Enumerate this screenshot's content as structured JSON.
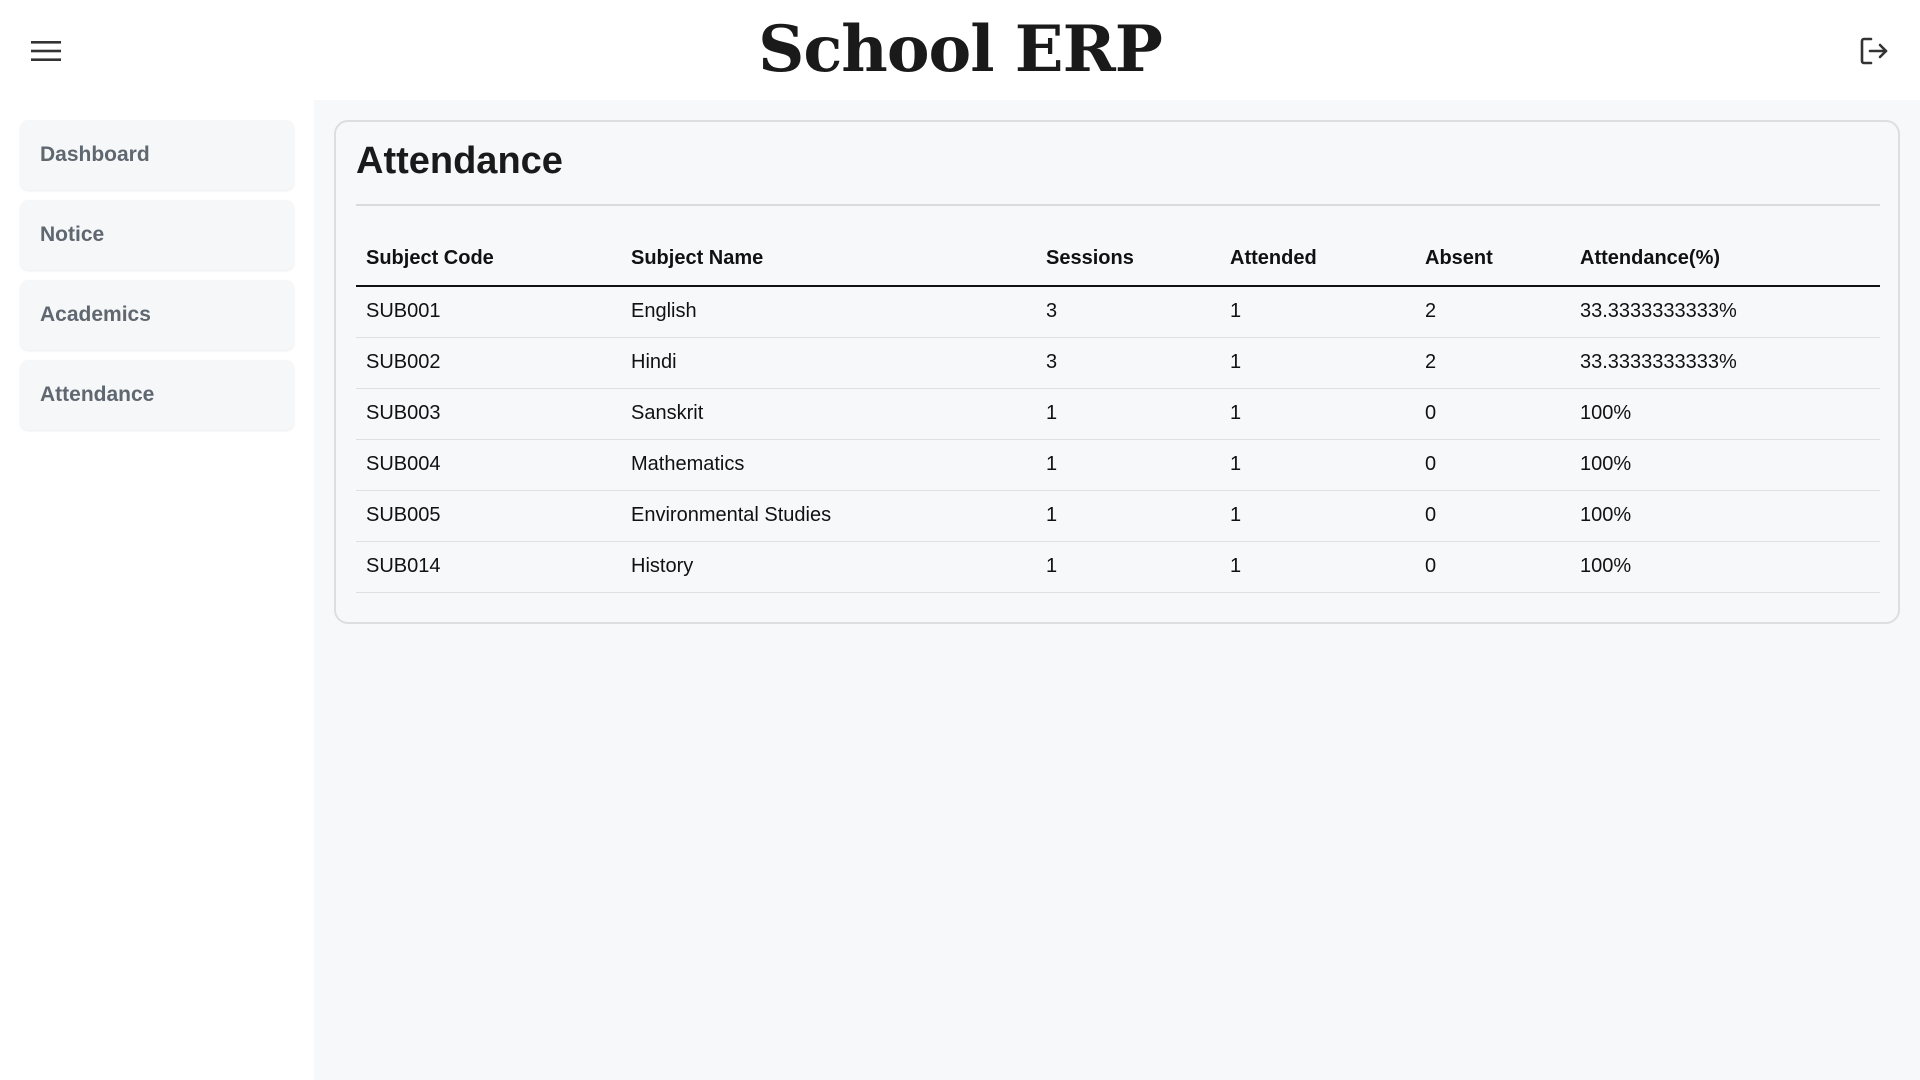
{
  "app": {
    "title": "School ERP",
    "menu_icon": "hamburger-menu-icon",
    "logout_icon": "logout-icon"
  },
  "sidebar": {
    "items": [
      {
        "label": "Dashboard"
      },
      {
        "label": "Notice"
      },
      {
        "label": "Academics"
      },
      {
        "label": "Attendance"
      }
    ]
  },
  "attendance": {
    "title": "Attendance",
    "columns": [
      "Subject Code",
      "Subject Name",
      "Sessions",
      "Attended",
      "Absent",
      "Attendance(%)"
    ],
    "rows": [
      [
        "SUB001",
        "English",
        "3",
        "1",
        "2",
        "33.3333333333%"
      ],
      [
        "SUB002",
        "Hindi",
        "3",
        "1",
        "2",
        "33.3333333333%"
      ],
      [
        "SUB003",
        "Sanskrit",
        "1",
        "1",
        "0",
        "100%"
      ],
      [
        "SUB004",
        "Mathematics",
        "1",
        "1",
        "0",
        "100%"
      ],
      [
        "SUB005",
        "Environmental Studies",
        "1",
        "1",
        "0",
        "100%"
      ],
      [
        "SUB014",
        "History",
        "1",
        "1",
        "0",
        "100%"
      ]
    ]
  },
  "colors": {
    "main_background": "#f7f8fa",
    "sidebar_item_background": "#f6f7f8",
    "sidebar_item_text": "#5f6770",
    "text_primary": "#111111"
  }
}
